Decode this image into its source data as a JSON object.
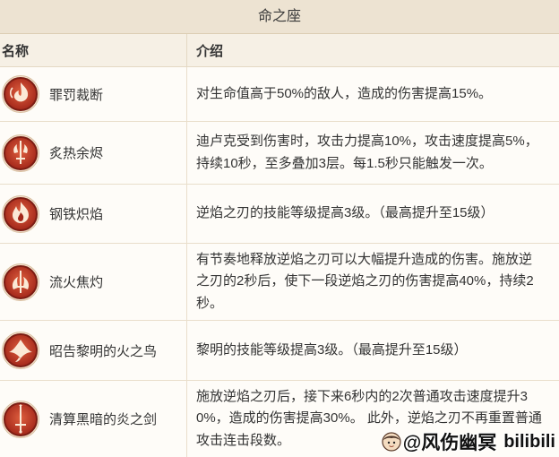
{
  "title": "命之座",
  "header": {
    "name": "名称",
    "desc": "介绍"
  },
  "rows": [
    {
      "icon": "flame-swirl-icon",
      "name": "罪罚裁断",
      "lines": [
        "对生命值高于50%的敌人，造成的伤害提高15%。"
      ]
    },
    {
      "icon": "flaming-sword-icon",
      "name": "炙热余烬",
      "lines": [
        "迪卢克受到伤害时，攻击力提高10%，攻击速度提高5%，",
        "持续10秒，至多叠加3层。每1.5秒只能触发一次。"
      ]
    },
    {
      "icon": "flame-icon",
      "name": "钢铁炽焰",
      "lines": [
        "逆焰之刃的技能等级提高3级。（最高提升至15级）"
      ]
    },
    {
      "icon": "sword-flame-icon",
      "name": "流火焦灼",
      "lines": [
        "有节奏地释放逆焰之刃可以大幅提升造成的伤害。施放逆",
        "之刃的2秒后，使下一段逆焰之刃的伤害提高40%，持续2",
        "秒。"
      ]
    },
    {
      "icon": "phoenix-icon",
      "name": "昭告黎明的火之鸟",
      "lines": [
        "黎明的技能等级提高3级。（最高提升至15级）"
      ]
    },
    {
      "icon": "sword-icon",
      "name": "清算黑暗的炎之剑",
      "lines": [
        "施放逆焰之刃后，接下来6秒内的2次普通攻击速度提升3",
        "0%，造成的伤害提高30%。 此外，逆焰之刃不再重置普通",
        "攻击连击段数。"
      ]
    }
  ],
  "watermark": {
    "handle": "@风伤幽冥",
    "brand": "bilibili"
  },
  "colors": {
    "icon_inner": "#de5f3e",
    "icon_outer": "#a3271a",
    "icon_ring": "#7c1d13",
    "icon_glyph": "#fbe9d6",
    "title_bg": "#ede3d2",
    "header_bg": "#f6f0e5",
    "border": "#e9decb"
  }
}
